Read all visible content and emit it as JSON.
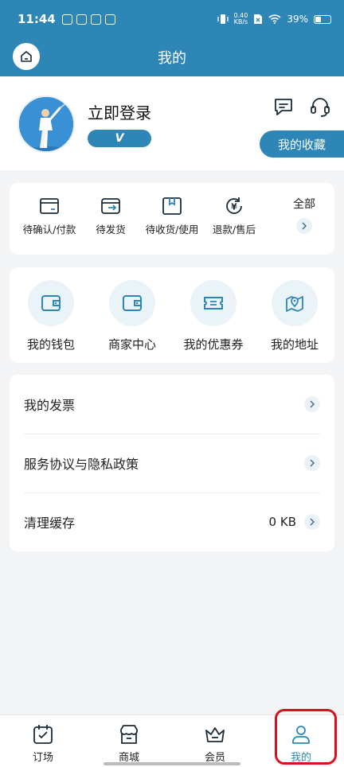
{
  "status_bar": {
    "time": "11:44",
    "net_speed_value": "0.40",
    "net_speed_unit": "KB/s",
    "battery": "39%"
  },
  "header": {
    "title": "我的"
  },
  "profile": {
    "login_label": "立即登录",
    "vip_badge": "V",
    "favorites_label": "我的收藏"
  },
  "orders": {
    "items": [
      {
        "label": "待确认/付款",
        "icon": "card-icon"
      },
      {
        "label": "待发货",
        "icon": "ship-box-icon"
      },
      {
        "label": "待收货/使用",
        "icon": "receive-box-icon"
      },
      {
        "label": "退款/售后",
        "icon": "refund-icon"
      }
    ],
    "all_label": "全部"
  },
  "services": {
    "items": [
      {
        "label": "我的钱包",
        "icon": "wallet-icon"
      },
      {
        "label": "商家中心",
        "icon": "merchant-icon"
      },
      {
        "label": "我的优惠券",
        "icon": "coupon-icon"
      },
      {
        "label": "我的地址",
        "icon": "map-pin-icon"
      }
    ]
  },
  "menu": {
    "invoice": "我的发票",
    "agreement": "服务协议与隐私政策",
    "cache": "清理缓存",
    "cache_size": "0 KB"
  },
  "tabs": {
    "items": [
      {
        "label": "订场",
        "icon": "calendar-check-icon"
      },
      {
        "label": "商城",
        "icon": "store-icon"
      },
      {
        "label": "会员",
        "icon": "crown-icon"
      },
      {
        "label": "我的",
        "icon": "person-icon"
      }
    ],
    "active_index": 3
  },
  "colors": {
    "primary": "#2e86b7",
    "highlight": "#d6101e",
    "background": "#f3f4f6"
  }
}
